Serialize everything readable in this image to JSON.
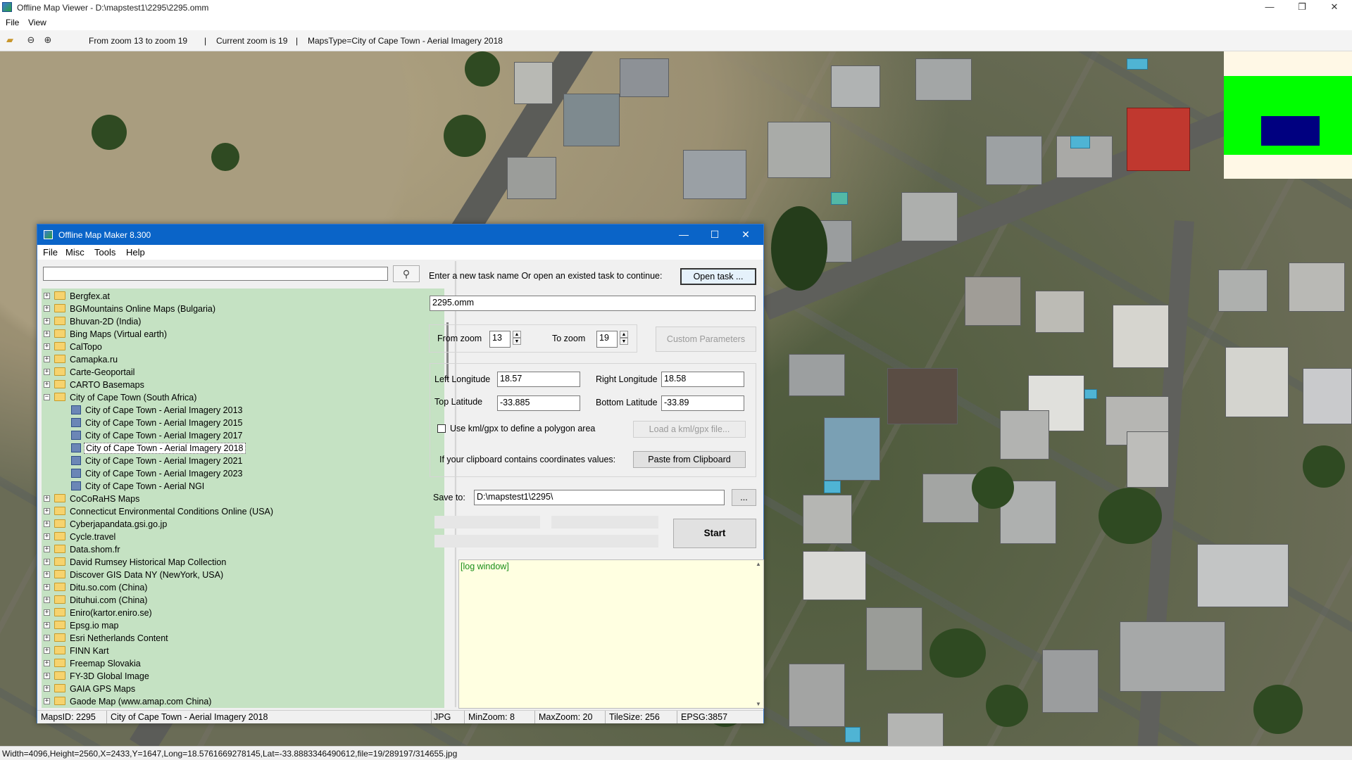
{
  "window": {
    "title": "Offline Map Viewer - D:\\mapstest1\\2295\\2295.omm",
    "controls": {
      "minimize": "—",
      "maximize": "❐",
      "close": "✕"
    }
  },
  "menu": {
    "file": "File",
    "view": "View"
  },
  "toolbar": {
    "zoom_range": "From zoom 13 to zoom 19",
    "sep1": "|",
    "current_zoom": "Current zoom is 19",
    "sep2": "|",
    "maps_type": "MapsType=City of Cape Town - Aerial Imagery 2018",
    "icons": {
      "open": "folder-open-icon",
      "zoom_out": "zoom-out-icon",
      "zoom_in": "zoom-in-icon"
    }
  },
  "status_bar": {
    "text": "Width=4096,Height=2560,X=2433,Y=1647,Long=18.5761669278145,Lat=-33.8883346490612,file=19/289197/314655.jpg"
  },
  "minimap": {
    "background": "#fff8e6",
    "band_color": "#00ff00",
    "view_color": "#000080"
  },
  "dialog": {
    "title": "Offline Map Maker 8.300",
    "controls": {
      "minimize": "—",
      "maximize": "☐",
      "close": "✕"
    },
    "menu": {
      "file": "File",
      "misc": "Misc",
      "tools": "Tools",
      "help": "Help"
    },
    "search": {
      "value": "",
      "button_icon": "search-icon"
    },
    "tree": [
      {
        "label": "Bergfex.at",
        "level": 0,
        "expanded": false
      },
      {
        "label": "BGMountains Online Maps (Bulgaria)",
        "level": 0,
        "expanded": false
      },
      {
        "label": "Bhuvan-2D (India)",
        "level": 0,
        "expanded": false
      },
      {
        "label": "Bing Maps (Virtual earth)",
        "level": 0,
        "expanded": false
      },
      {
        "label": "CalTopo",
        "level": 0,
        "expanded": false
      },
      {
        "label": "Camapka.ru",
        "level": 0,
        "expanded": false
      },
      {
        "label": "Carte-Geoportail",
        "level": 0,
        "expanded": false
      },
      {
        "label": "CARTO Basemaps",
        "level": 0,
        "expanded": false
      },
      {
        "label": "City of Cape Town (South Africa)",
        "level": 0,
        "expanded": true
      },
      {
        "label": "City of Cape Town - Aerial Imagery 2013",
        "level": 1
      },
      {
        "label": "City of Cape Town - Aerial Imagery 2015",
        "level": 1
      },
      {
        "label": "City of Cape Town - Aerial Imagery 2017",
        "level": 1
      },
      {
        "label": "City of Cape Town - Aerial Imagery 2018",
        "level": 1,
        "selected": true
      },
      {
        "label": "City of Cape Town - Aerial Imagery 2021",
        "level": 1
      },
      {
        "label": "City of Cape Town - Aerial Imagery 2023",
        "level": 1
      },
      {
        "label": "City of Cape Town - Aerial NGI",
        "level": 1
      },
      {
        "label": "CoCoRaHS Maps",
        "level": 0,
        "expanded": false
      },
      {
        "label": "Connecticut Environmental Conditions Online (USA)",
        "level": 0,
        "expanded": false
      },
      {
        "label": "Cyberjapandata.gsi.go.jp",
        "level": 0,
        "expanded": false
      },
      {
        "label": "Cycle.travel",
        "level": 0,
        "expanded": false
      },
      {
        "label": "Data.shom.fr",
        "level": 0,
        "expanded": false
      },
      {
        "label": "David Rumsey Historical Map Collection",
        "level": 0,
        "expanded": false
      },
      {
        "label": "Discover GIS Data NY (NewYork, USA)",
        "level": 0,
        "expanded": false
      },
      {
        "label": "Ditu.so.com (China)",
        "level": 0,
        "expanded": false
      },
      {
        "label": "Dituhui.com (China)",
        "level": 0,
        "expanded": false
      },
      {
        "label": "Eniro(kartor.eniro.se)",
        "level": 0,
        "expanded": false
      },
      {
        "label": "Epsg.io map",
        "level": 0,
        "expanded": false
      },
      {
        "label": "Esri Netherlands Content",
        "level": 0,
        "expanded": false
      },
      {
        "label": "FINN Kart",
        "level": 0,
        "expanded": false
      },
      {
        "label": "Freemap Slovakia",
        "level": 0,
        "expanded": false
      },
      {
        "label": "FY-3D Global Image",
        "level": 0,
        "expanded": false
      },
      {
        "label": "GAIA GPS Maps",
        "level": 0,
        "expanded": false
      },
      {
        "label": "Gaode Map (www.amap.com China)",
        "level": 0,
        "expanded": false
      }
    ],
    "task": {
      "prompt": "Enter a new task name Or open an existed task to continue:",
      "open_button": "Open task ...",
      "name_value": "2295.omm"
    },
    "zoom": {
      "from_label": "From zoom",
      "from_value": "13",
      "to_label": "To zoom",
      "to_value": "19",
      "custom_button": "Custom Parameters"
    },
    "coords": {
      "left_label": "Left Longitude",
      "left_value": "18.57",
      "right_label": "Right Longitude",
      "right_value": "18.58",
      "top_label": "Top Latitude",
      "top_value": "-33.885",
      "bottom_label": "Bottom Latitude",
      "bottom_value": "-33.89",
      "kml_checkbox_label": "Use kml/gpx to define a polygon area",
      "kml_button": "Load a kml/gpx file...",
      "clipboard_label": "If your clipboard contains coordinates values:",
      "clipboard_button": "Paste from Clipboard"
    },
    "save": {
      "label": "Save to:",
      "value": "D:\\mapstest1\\2295\\",
      "browse_button": "..."
    },
    "start_button": "Start",
    "log": {
      "text": "[log window]"
    },
    "status": {
      "maps_id": "MapsID: 2295",
      "maps_name": "City of Cape Town - Aerial Imagery 2018",
      "format": "JPG",
      "min_zoom": "MinZoom: 8",
      "max_zoom": "MaxZoom: 20",
      "tile_size": "TileSize: 256",
      "epsg": "EPSG:3857"
    }
  }
}
